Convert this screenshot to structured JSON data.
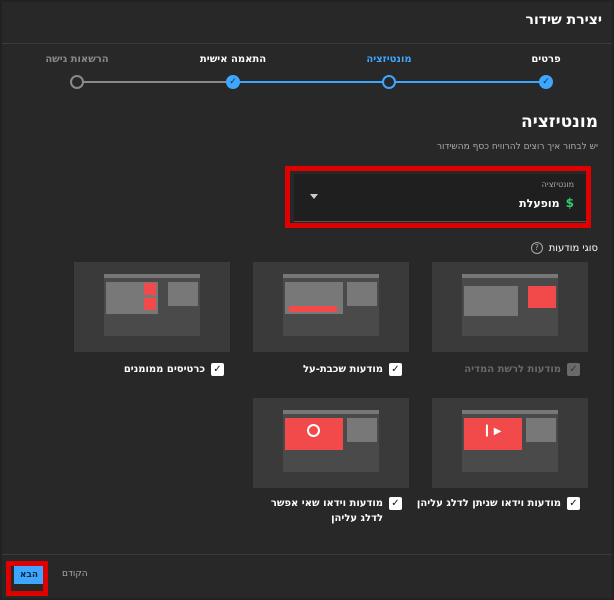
{
  "dialog": {
    "title": "יצירת שידור"
  },
  "stepper": {
    "steps": [
      {
        "label": "פרטים",
        "state": "done"
      },
      {
        "label": "מונטיזציה",
        "state": "current"
      },
      {
        "label": "התאמה אישית",
        "state": "done"
      },
      {
        "label": "הרשאות גישה",
        "state": "pending"
      }
    ],
    "check_glyph": "✓"
  },
  "monetization": {
    "title": "מונטיזציה",
    "subtitle": "יש לבחור איך רוצים להרוויח כסף מהשידור",
    "dropdown_label": "מונטיזציה",
    "dropdown_value": "מופעלת",
    "dollar_glyph": "$"
  },
  "ad_types": {
    "title": "סוגי מודעות",
    "help_glyph": "?",
    "options": [
      {
        "label": "מודעות לרשת המדיה",
        "checked": true,
        "disabled": true
      },
      {
        "label": "מודעות שכבת-על",
        "checked": true,
        "disabled": false
      },
      {
        "label": "כרטיסים ממומנים",
        "checked": true,
        "disabled": false
      },
      {
        "label": "מודעות וידאו שניתן לדלג עליהן",
        "checked": true,
        "disabled": false
      },
      {
        "label": "מודעות וידאו שאי אפשר לדלג עליהן",
        "checked": true,
        "disabled": false
      }
    ],
    "check_glyph": "✓"
  },
  "footer": {
    "next_label": "הבא",
    "prev_label": "הקודם"
  },
  "colors": {
    "accent": "#3ea6ff",
    "highlight": "#e10000",
    "ad_red": "#f24a4a",
    "money_green": "#2ecc71"
  }
}
